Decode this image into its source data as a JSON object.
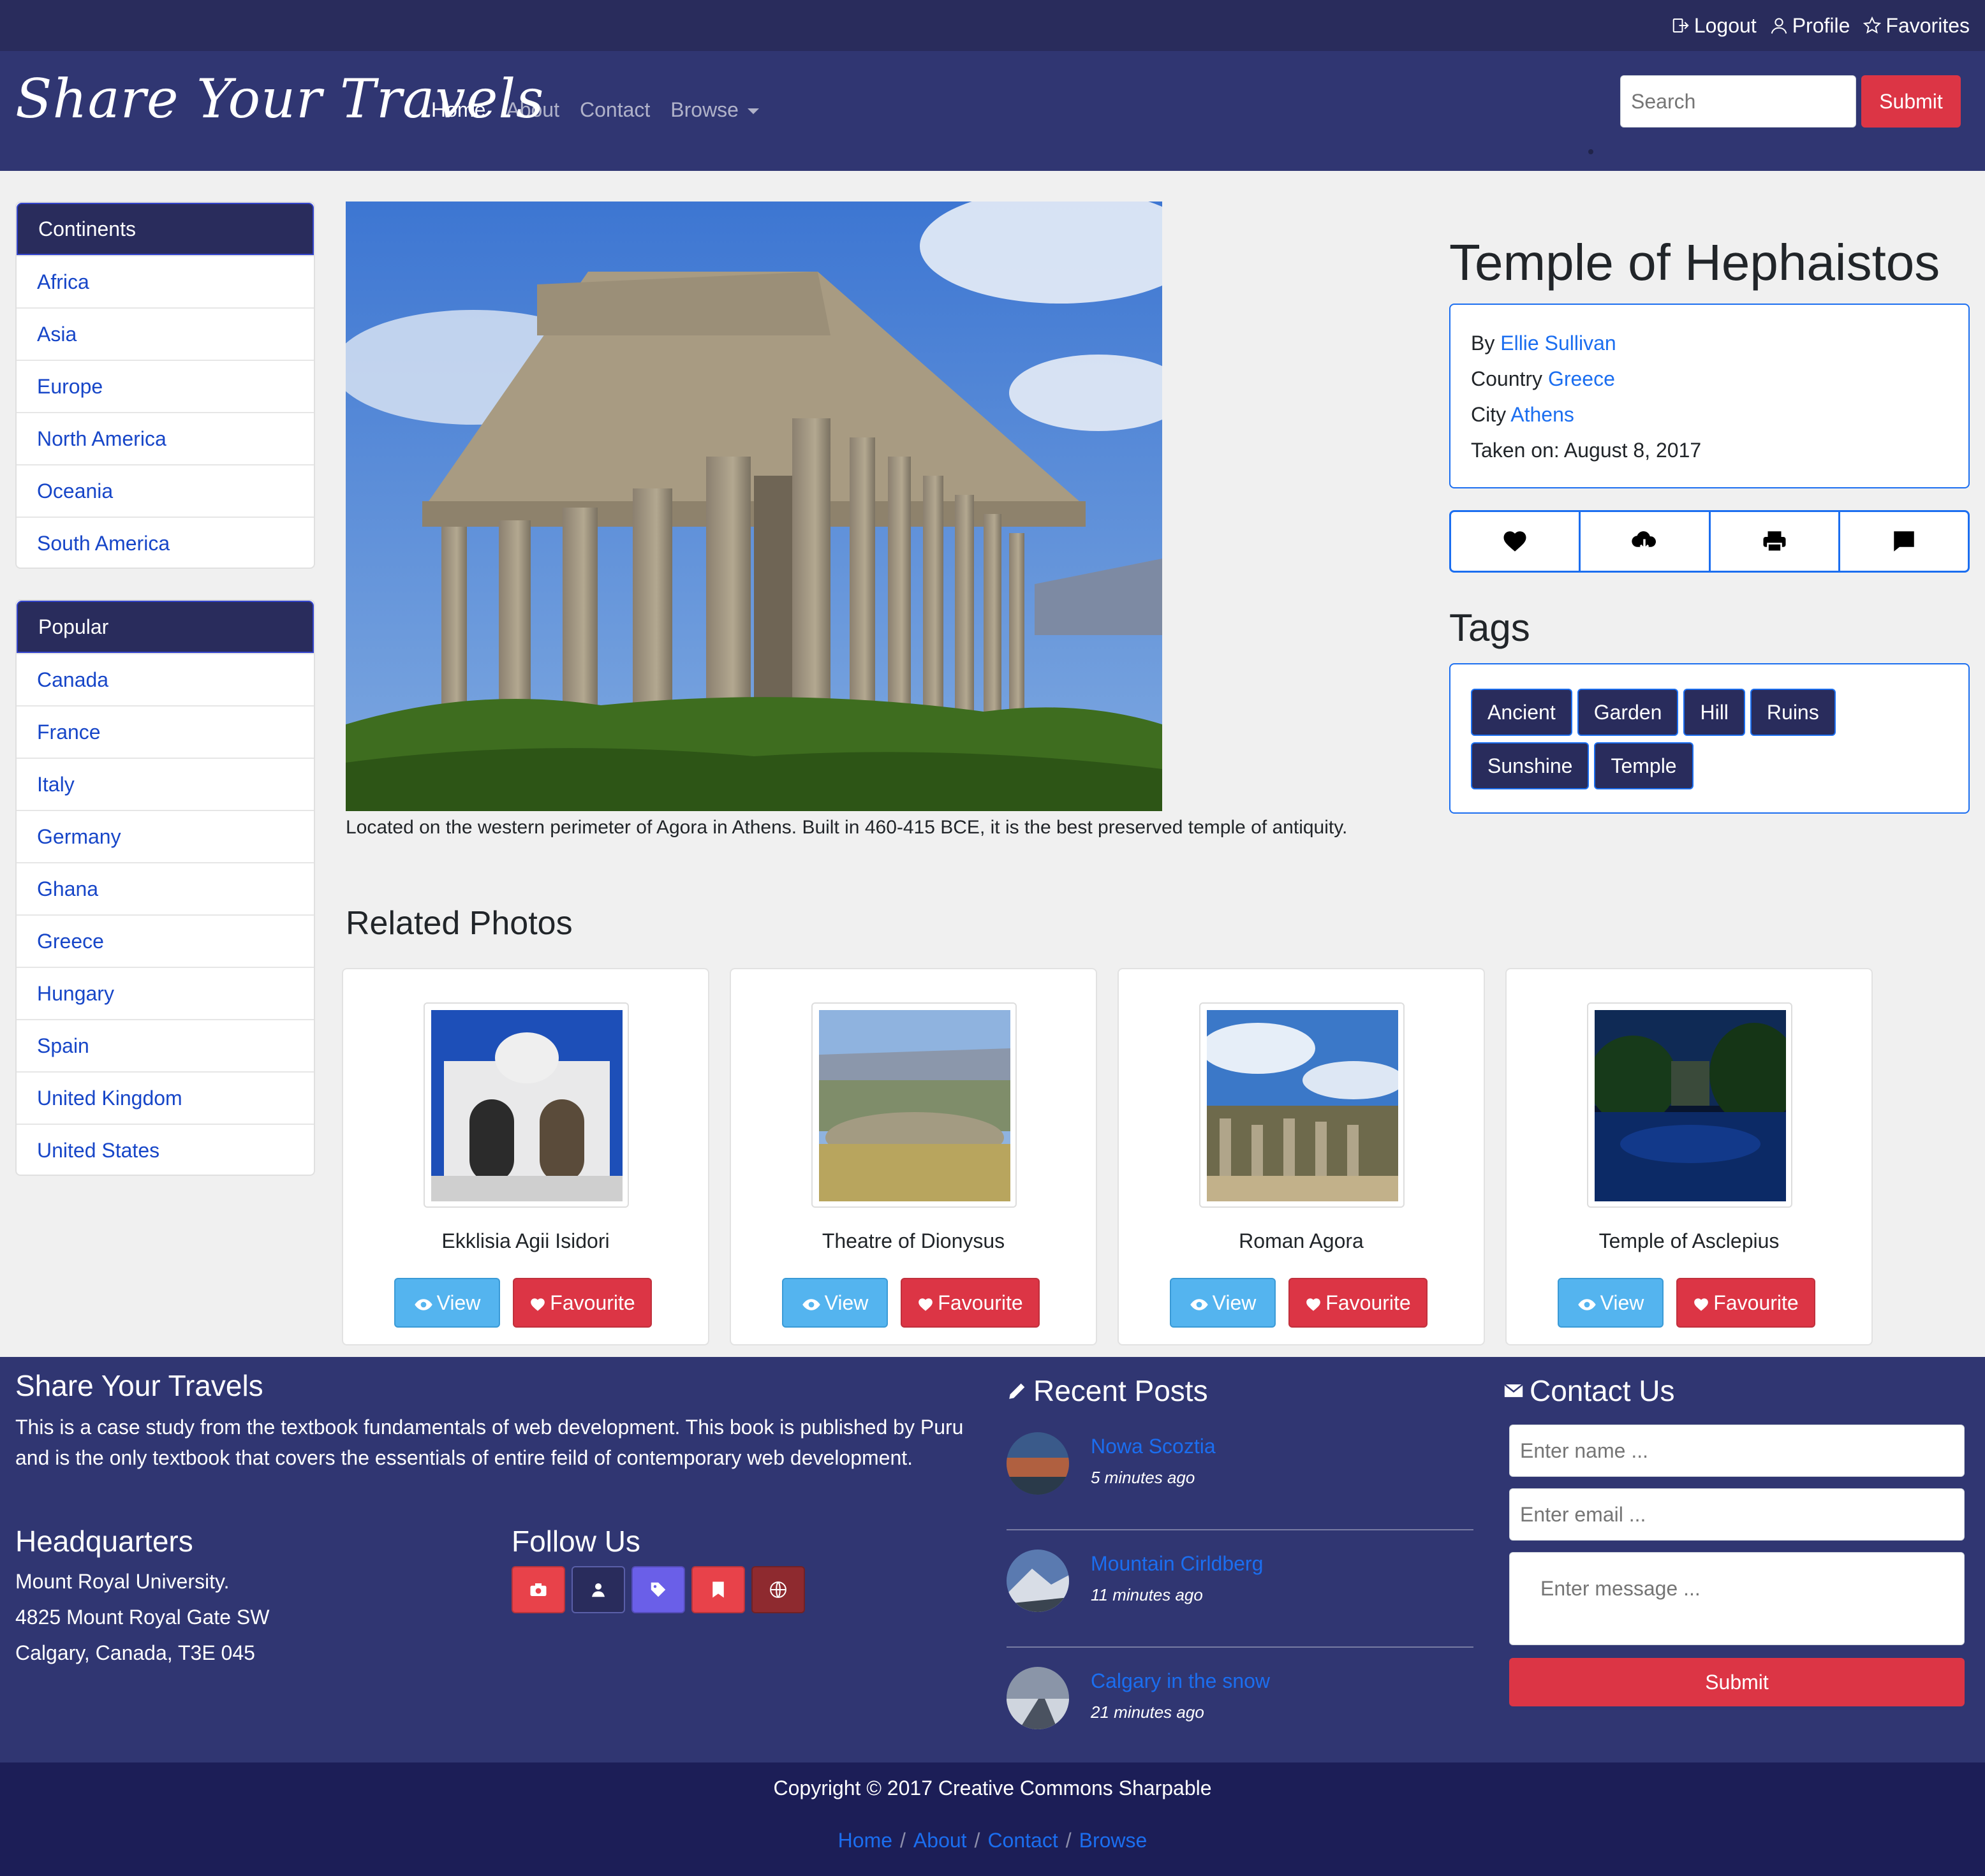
{
  "topbar": {
    "logout": "Logout",
    "profile": "Profile",
    "favorites": "Favorites"
  },
  "navbar": {
    "brand": "Share Your Travels",
    "links": [
      "Home",
      "About",
      "Contact",
      "Browse"
    ],
    "search_placeholder": "Search",
    "search_button": "Submit"
  },
  "sidebar": {
    "continents_title": "Continents",
    "continents": [
      "Africa",
      "Asia",
      "Europe",
      "North America",
      "Oceania",
      "South America"
    ],
    "popular_title": "Popular",
    "popular": [
      "Canada",
      "France",
      "Italy",
      "Germany",
      "Ghana",
      "Greece",
      "Hungary",
      "Spain",
      "United Kingdom",
      "United States"
    ]
  },
  "photo": {
    "title": "Temple of Hephaistos",
    "description": "Located on the western perimeter of Agora in Athens. Built in 460-415 BCE, it is the best preserved temple of antiquity.",
    "by_label": "By",
    "author": "Ellie Sullivan",
    "country_label": "Country",
    "country": "Greece",
    "city_label": "City",
    "city": "Athens",
    "taken": "Taken on: August 8, 2017",
    "actions": [
      "heart-icon",
      "cloud-download-icon",
      "printer-icon",
      "chat-icon"
    ]
  },
  "tags": {
    "title": "Tags",
    "items": [
      "Ancient",
      "Garden",
      "Hill",
      "Ruins",
      "Sunshine",
      "Temple"
    ]
  },
  "related": {
    "title": "Related Photos",
    "view_label": "View",
    "fav_label": "Favourite",
    "items": [
      {
        "name": "Ekklisia Agii Isidori"
      },
      {
        "name": "Theatre of Dionysus"
      },
      {
        "name": "Roman Agora"
      },
      {
        "name": "Temple of Asclepius"
      }
    ]
  },
  "footer": {
    "about_title": "Share Your Travels",
    "about_text": "This is a case study from the textbook fundamentals of web development. This book is published by Puru and is the only textbook that covers the essentials of entire feild of contemporary web development.",
    "hq_title": "Headquarters",
    "hq_lines": [
      "Mount Royal University.",
      "4825 Mount Royal Gate SW",
      "Calgary, Canada, T3E 045"
    ],
    "follow_title": "Follow Us",
    "posts_title": "Recent Posts",
    "posts": [
      {
        "title": "Nowa Scoztia",
        "time": "5 minutes ago"
      },
      {
        "title": "Mountain Cirldberg",
        "time": "11 minutes ago"
      },
      {
        "title": "Calgary in the snow",
        "time": "21 minutes ago"
      }
    ],
    "contact_title": "Contact Us",
    "name_placeholder": "Enter name ...",
    "email_placeholder": "Enter email ...",
    "message_placeholder": "Enter message ...",
    "submit": "Submit",
    "copyright": "Copyright © 2017 Creative Commons Sharpable",
    "bottom_links": [
      "Home",
      "About",
      "Contact",
      "Browse"
    ]
  },
  "colors": {
    "navy": "#303672",
    "dark_navy": "#292c5c",
    "red": "#dc3545",
    "blue": "#1b6ef0",
    "light_blue": "#54b4ef"
  }
}
